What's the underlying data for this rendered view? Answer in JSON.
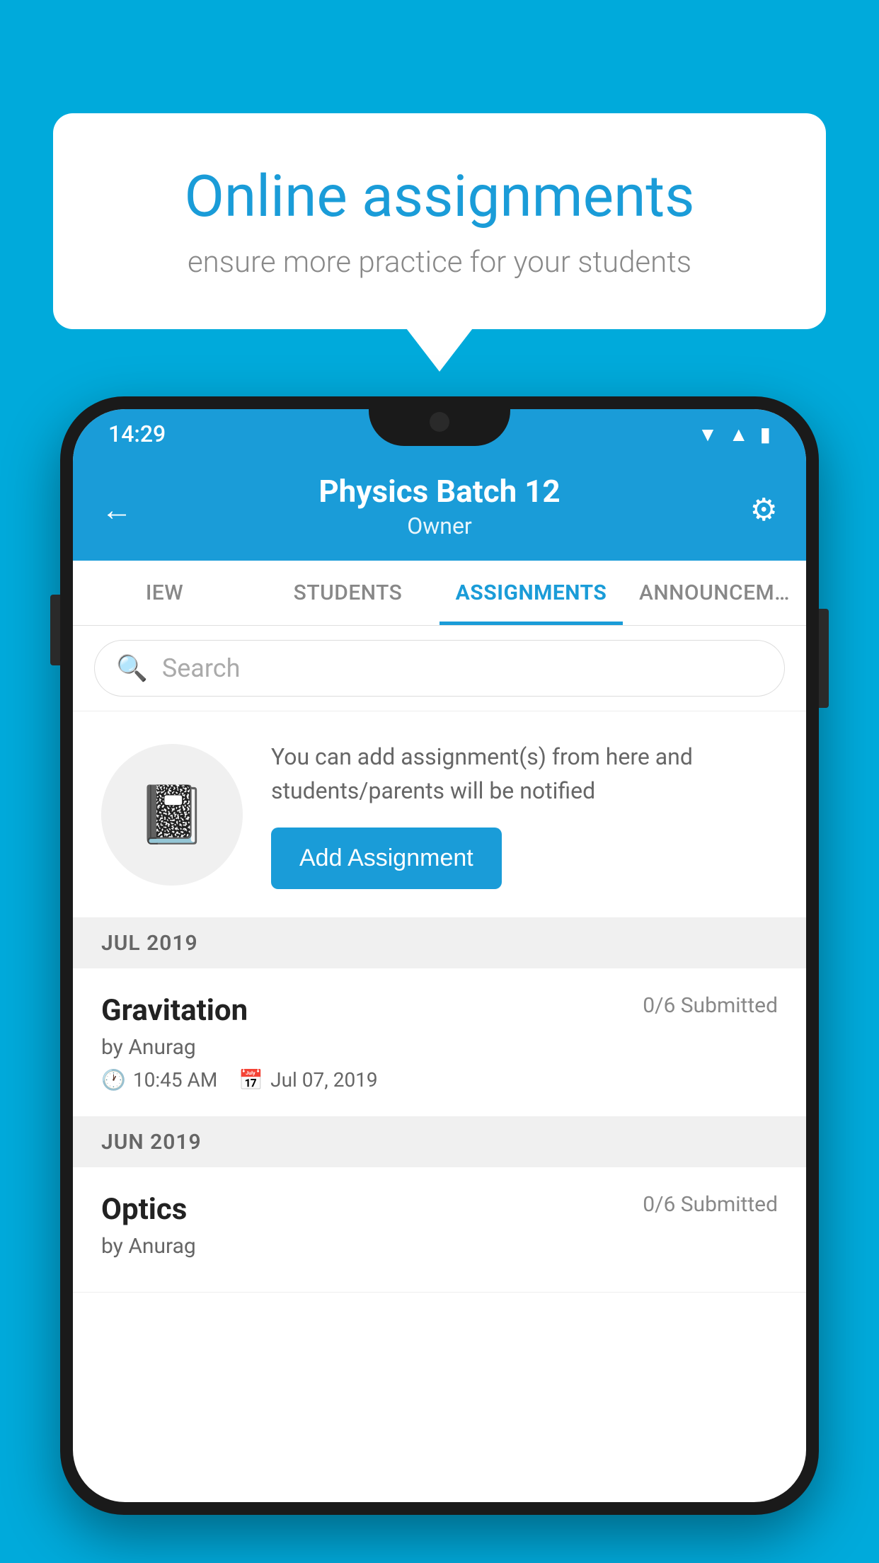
{
  "background_color": "#00AADB",
  "speech_bubble": {
    "title": "Online assignments",
    "subtitle": "ensure more practice for your students"
  },
  "phone": {
    "status_bar": {
      "time": "14:29"
    },
    "header": {
      "title": "Physics Batch 12",
      "subtitle": "Owner",
      "back_label": "←",
      "settings_label": "⚙"
    },
    "tabs": [
      {
        "label": "IEW",
        "active": false
      },
      {
        "label": "STUDENTS",
        "active": false
      },
      {
        "label": "ASSIGNMENTS",
        "active": true
      },
      {
        "label": "ANNOUNCEM…",
        "active": false
      }
    ],
    "search": {
      "placeholder": "Search"
    },
    "promo": {
      "icon": "📓",
      "text": "You can add assignment(s) from here and students/parents will be notified",
      "button_label": "Add Assignment"
    },
    "sections": [
      {
        "label": "JUL 2019",
        "items": [
          {
            "name": "Gravitation",
            "submitted": "0/6 Submitted",
            "by": "by Anurag",
            "time": "10:45 AM",
            "date": "Jul 07, 2019"
          }
        ]
      },
      {
        "label": "JUN 2019",
        "items": [
          {
            "name": "Optics",
            "submitted": "0/6 Submitted",
            "by": "by Anurag",
            "time": "",
            "date": ""
          }
        ]
      }
    ]
  }
}
